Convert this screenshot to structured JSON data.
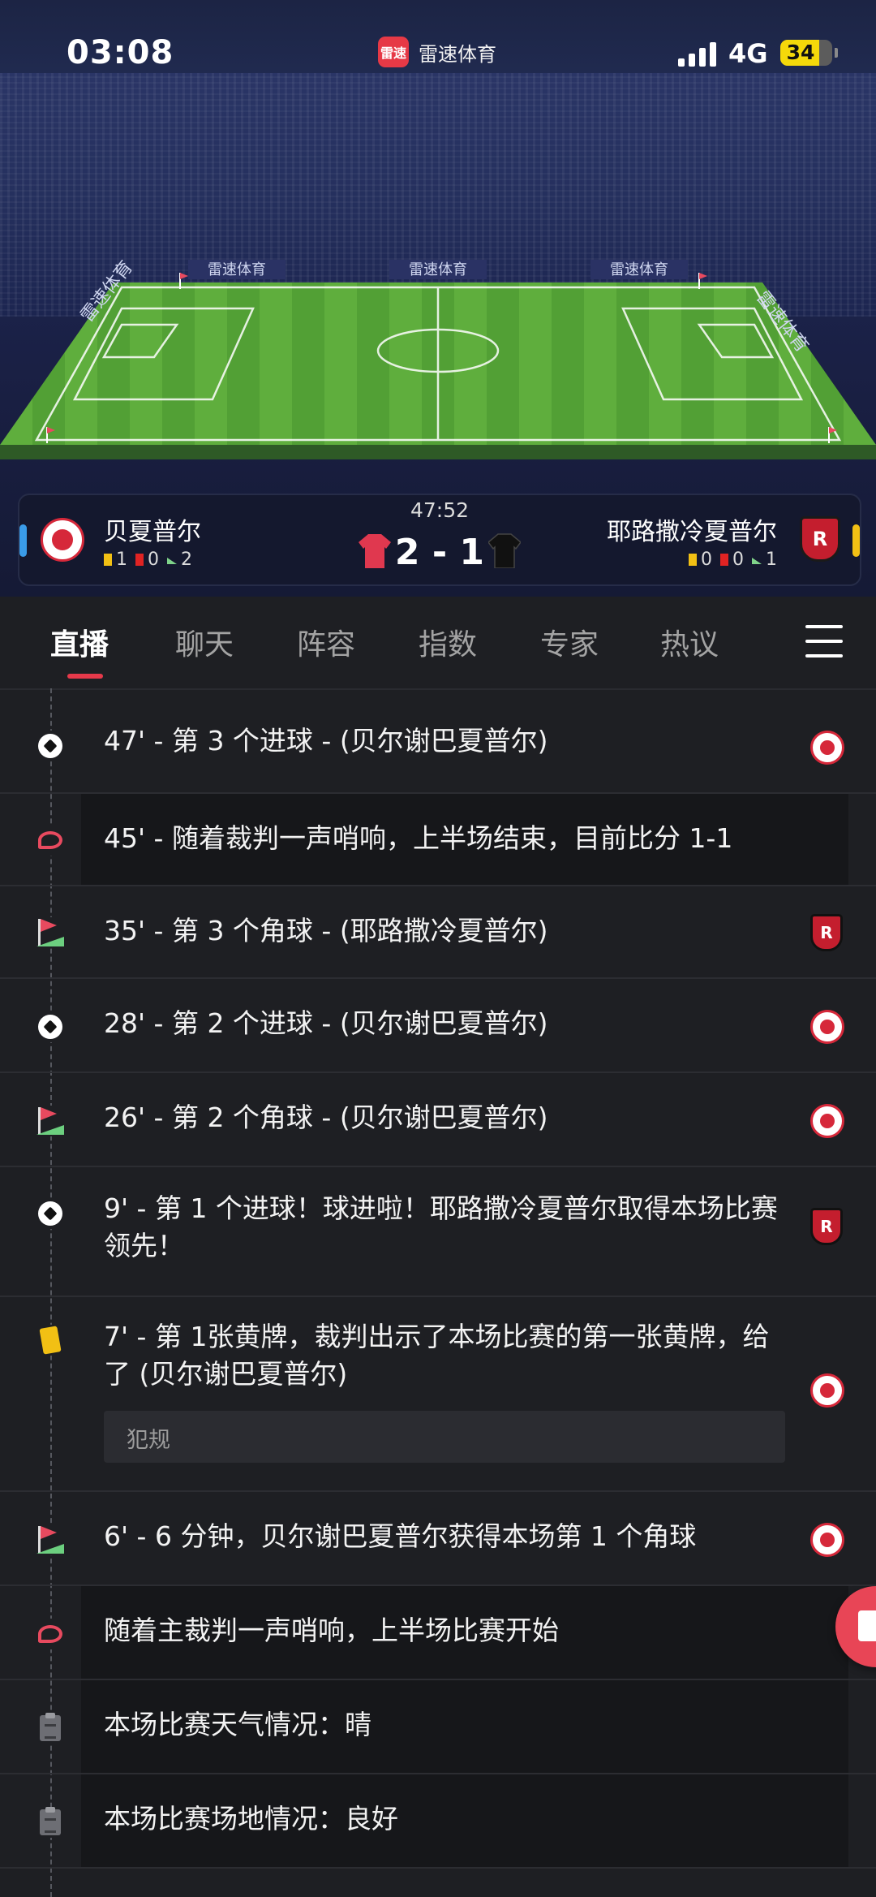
{
  "status_bar": {
    "time": "03:08",
    "app_logo_text": "雷速",
    "app_name": "雷速体育",
    "network": "4G",
    "battery": "34",
    "battery_level": 0.34,
    "battery_color": "#f5d90a"
  },
  "stadium": {
    "ad_boards": [
      "雷速体育",
      "雷速体育",
      "雷速体育"
    ],
    "side_boards": [
      "雷速体育",
      "雷速体育"
    ],
    "pitch_color": "#5aa83a"
  },
  "match": {
    "minute": "47:52",
    "score": "2 - 1",
    "home": {
      "name": "贝夏普尔",
      "yellow": "1",
      "red": "0",
      "corners": "2",
      "indicator_color": "#3a9be8",
      "kit_color": "#e0384f"
    },
    "away": {
      "name": "耶路撒冷夏普尔",
      "yellow": "0",
      "red": "0",
      "corners": "1",
      "indicator_color": "#f2c014",
      "kit_color": "#111111",
      "badge_letter": "R"
    }
  },
  "tabs": [
    "直播",
    "聊天",
    "阵容",
    "指数",
    "专家",
    "热议"
  ],
  "active_tab": "直播",
  "events": [
    {
      "icon": "soccer-ball-icon",
      "text": "47' - 第 3 个进球 - (贝尔谢巴夏普尔)",
      "team": "home"
    },
    {
      "icon": "whistle-icon",
      "text": "45' - 随着裁判一声哨响，上半场结束，目前比分 1-1",
      "team": ""
    },
    {
      "icon": "corner-flag-icon",
      "text": "35' - 第 3 个角球 - (耶路撒冷夏普尔)",
      "team": "away"
    },
    {
      "icon": "soccer-ball-icon",
      "text": "28' - 第 2 个进球 - (贝尔谢巴夏普尔)",
      "team": "home"
    },
    {
      "icon": "corner-flag-icon",
      "text": "26' - 第 2 个角球 - (贝尔谢巴夏普尔)",
      "team": "home"
    },
    {
      "icon": "soccer-ball-icon",
      "text": "9' - 第 1 个进球！球进啦！耶路撒冷夏普尔取得本场比赛领先！",
      "team": "away"
    },
    {
      "icon": "yellow-card-icon",
      "text": "7' - 第 1张黄牌，裁判出示了本场比赛的第一张黄牌，给了 (贝尔谢巴夏普尔)",
      "team": "home",
      "tag": "犯规"
    },
    {
      "icon": "corner-flag-icon",
      "text": "6' - 6 分钟，贝尔谢巴夏普尔获得本场第 1 个角球",
      "team": "home"
    },
    {
      "icon": "whistle-icon",
      "text": "随着主裁判一声哨响，上半场比赛开始",
      "team": ""
    },
    {
      "icon": "clipboard-icon",
      "text": "本场比赛天气情况：晴",
      "team": ""
    },
    {
      "icon": "clipboard-icon",
      "text": "本场比赛场地情况：良好",
      "team": ""
    }
  ]
}
